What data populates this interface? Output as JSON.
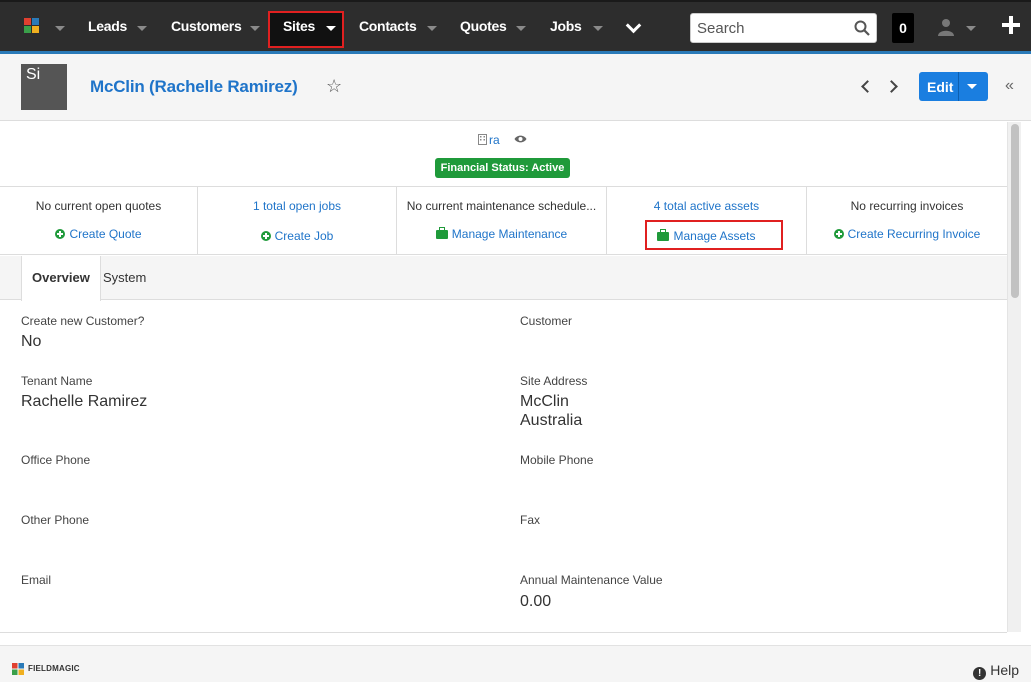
{
  "topnav": {
    "items": [
      {
        "label": "Leads"
      },
      {
        "label": "Customers"
      },
      {
        "label": "Sites"
      },
      {
        "label": "Contacts"
      },
      {
        "label": "Quotes"
      },
      {
        "label": "Jobs"
      }
    ],
    "search_placeholder": "Search",
    "notification_count": "0",
    "colors": {
      "bar": "#2d2d2d",
      "accent": "#2a7ab8",
      "highlight_box": "#e02020"
    }
  },
  "header": {
    "avatar_initials": "Si",
    "title": "McClin (Rachelle Ramirez)",
    "edit_label": "Edit"
  },
  "info": {
    "building_text": "ra",
    "financial_status": "Financial Status: Active"
  },
  "stats": [
    {
      "top": "No current open quotes",
      "top_is_link": false,
      "action": "Create Quote",
      "action_icon": "plus-circle-icon"
    },
    {
      "top": "1 total open jobs",
      "top_is_link": true,
      "action": "Create Job",
      "action_icon": "plus-circle-icon"
    },
    {
      "top": "No current maintenance schedule...",
      "top_is_link": false,
      "action": "Manage Maintenance",
      "action_icon": "briefcase-icon"
    },
    {
      "top": "4 total active assets",
      "top_is_link": true,
      "action": "Manage Assets",
      "action_icon": "briefcase-icon"
    },
    {
      "top": "No recurring invoices",
      "top_is_link": false,
      "action": "Create Recurring Invoice",
      "action_icon": "plus-circle-icon"
    }
  ],
  "tabs": {
    "overview": "Overview",
    "system": "System"
  },
  "fields": {
    "create_customer": {
      "label": "Create new Customer?",
      "value": "No"
    },
    "customer": {
      "label": "Customer",
      "value": ""
    },
    "tenant_name": {
      "label": "Tenant Name",
      "value": "Rachelle Ramirez"
    },
    "site_address": {
      "label": "Site Address",
      "line1": "McClin",
      "line2": "Australia"
    },
    "office_phone": {
      "label": "Office Phone",
      "value": ""
    },
    "mobile_phone": {
      "label": "Mobile Phone",
      "value": ""
    },
    "other_phone": {
      "label": "Other Phone",
      "value": ""
    },
    "fax": {
      "label": "Fax",
      "value": ""
    },
    "email": {
      "label": "Email",
      "value": ""
    },
    "annual_maintenance": {
      "label": "Annual Maintenance Value",
      "value": "0.00"
    }
  },
  "footer": {
    "brand": "FIELDMAGIC",
    "help_label": "Help"
  }
}
